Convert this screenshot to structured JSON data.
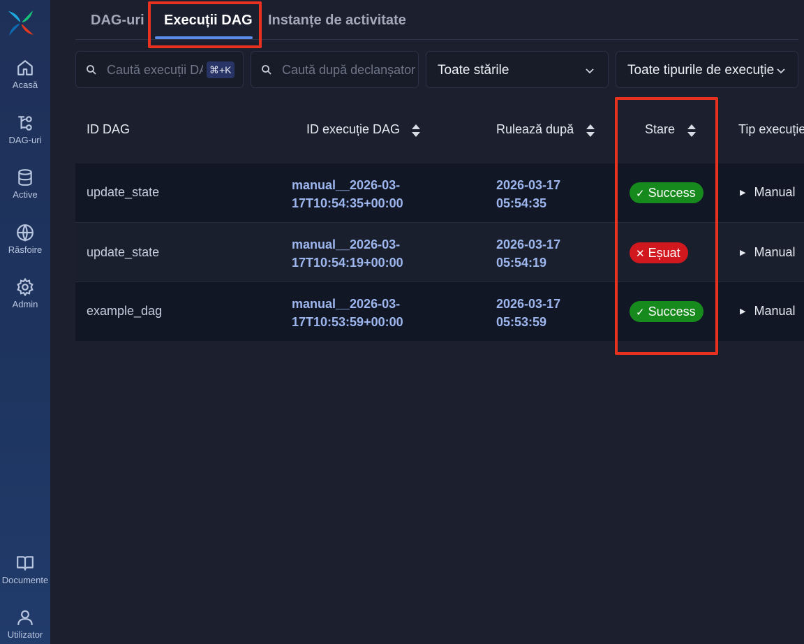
{
  "sidebar": {
    "items": [
      {
        "label": "Acasă",
        "icon": "home-icon"
      },
      {
        "label": "DAG-uri",
        "icon": "dag-icon"
      },
      {
        "label": "Active",
        "icon": "database-icon"
      },
      {
        "label": "Răsfoire",
        "icon": "globe-icon"
      },
      {
        "label": "Admin",
        "icon": "gear-icon"
      }
    ],
    "bottom": [
      {
        "label": "Documente",
        "icon": "book-icon"
      },
      {
        "label": "Utilizator",
        "icon": "user-icon"
      }
    ]
  },
  "tabs": [
    {
      "label": "DAG-uri",
      "active": false
    },
    {
      "label": "Execuții DAG",
      "active": true
    },
    {
      "label": "Instanțe de activitate",
      "active": false
    }
  ],
  "filters": {
    "search_runs_placeholder": "Caută execuții DAG",
    "search_runs_shortcut": "⌘+K",
    "search_trigger_placeholder": "Caută după declanșator",
    "state_select": "Toate stările",
    "type_select": "Toate tipurile de execuție"
  },
  "table": {
    "headers": {
      "dag_id": "ID DAG",
      "run_id": "ID execuție DAG",
      "run_after": "Rulează după",
      "state": "Stare",
      "run_type": "Tip execuție"
    },
    "rows": [
      {
        "dag_id": "update_state",
        "run_id_1": "manual__2026-03-",
        "run_id_2": "17T10:54:35+00:00",
        "date": "2026-03-17",
        "time": "05:54:35",
        "state": "Success",
        "state_kind": "success",
        "run_type": "Manual"
      },
      {
        "dag_id": "update_state",
        "run_id_1": "manual__2026-03-",
        "run_id_2": "17T10:54:19+00:00",
        "date": "2026-03-17",
        "time": "05:54:19",
        "state": "Eșuat",
        "state_kind": "failed",
        "run_type": "Manual"
      },
      {
        "dag_id": "example_dag",
        "run_id_1": "manual__2026-03-",
        "run_id_2": "17T10:53:59+00:00",
        "date": "2026-03-17",
        "time": "05:53:59",
        "state": "Success",
        "state_kind": "success",
        "run_type": "Manual"
      }
    ]
  },
  "colors": {
    "accent": "#5b8be8",
    "highlight": "#e8321f",
    "success": "#178a1d",
    "failed": "#d1181e"
  }
}
